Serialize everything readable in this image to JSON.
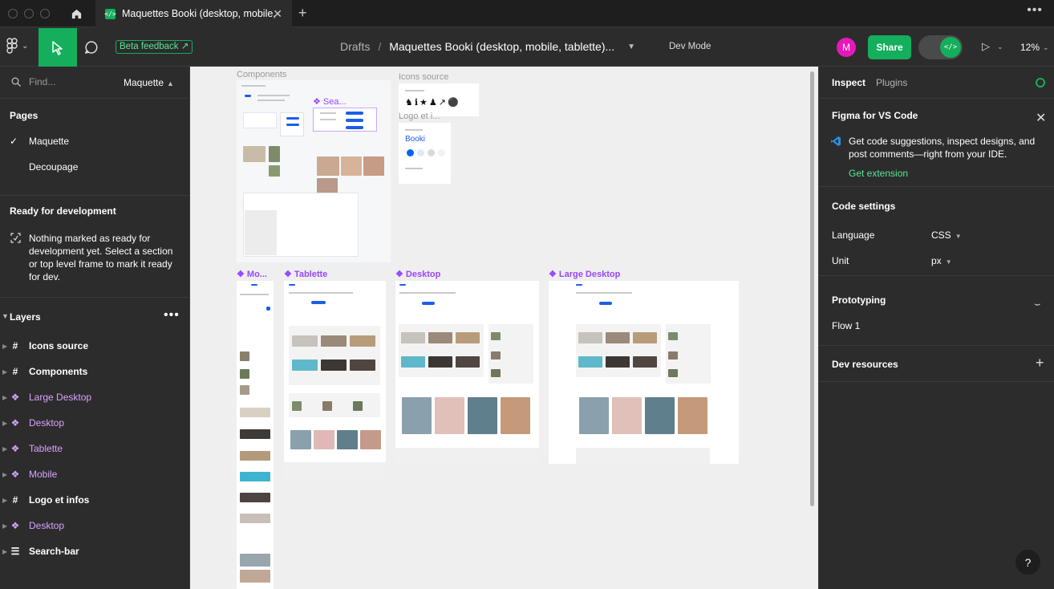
{
  "tabbar": {
    "tab_title": "Maquettes Booki (desktop, mobile,",
    "new_tab": "+",
    "close": "✕"
  },
  "toolbar": {
    "beta_feedback": "Beta feedback ↗",
    "breadcrumb_drafts": "Drafts",
    "breadcrumb_sep": "/",
    "file_name": "Maquettes Booki (desktop, mobile, tablette)...",
    "dev_mode": "Dev Mode",
    "avatar_initial": "M",
    "share": "Share",
    "zoom": "12%",
    "toggle_icon": "</>"
  },
  "left": {
    "search_placeholder": "Find...",
    "page_select": "Maquette",
    "pages_title": "Pages",
    "pages": [
      "Maquette",
      "Decoupage"
    ],
    "ready_title": "Ready for development",
    "ready_text": "Nothing marked as ready for development yet. Select a section or top level frame to mark it ready for dev.",
    "layers_title": "Layers",
    "layers": [
      {
        "name": "Icons source",
        "type": "frame"
      },
      {
        "name": "Components",
        "type": "frame"
      },
      {
        "name": "Large Desktop",
        "type": "component"
      },
      {
        "name": "Desktop",
        "type": "component"
      },
      {
        "name": "Tablette",
        "type": "component"
      },
      {
        "name": "Mobile",
        "type": "component"
      },
      {
        "name": "Logo et infos",
        "type": "frame"
      },
      {
        "name": "Desktop",
        "type": "component"
      },
      {
        "name": "Search-bar",
        "type": "text"
      }
    ]
  },
  "canvas": {
    "components_label": "Components",
    "search_label": "Sea...",
    "icons_label": "Icons source",
    "logo_label": "Logo et i...",
    "mobile_label": "Mo...",
    "tablette_label": "Tablette",
    "desktop_label": "Desktop",
    "large_desktop_label": "Large Desktop",
    "logo_text": "Booki"
  },
  "right": {
    "tab_inspect": "Inspect",
    "tab_plugins": "Plugins",
    "vscode_title": "Figma for VS Code",
    "vscode_desc": "Get code suggestions, inspect designs, and post comments—right from your IDE.",
    "vscode_link": "Get extension",
    "code_settings_title": "Code settings",
    "language_key": "Language",
    "language_val": "CSS",
    "unit_key": "Unit",
    "unit_val": "px",
    "prototyping_title": "Prototyping",
    "flow": "Flow 1",
    "dev_resources_title": "Dev resources",
    "help": "?"
  },
  "colors": {
    "accent": "#14ae5c",
    "component": "#9747ff",
    "avatar": "#e619b8",
    "canvas": "#efefef",
    "panel": "#2c2c2c"
  }
}
